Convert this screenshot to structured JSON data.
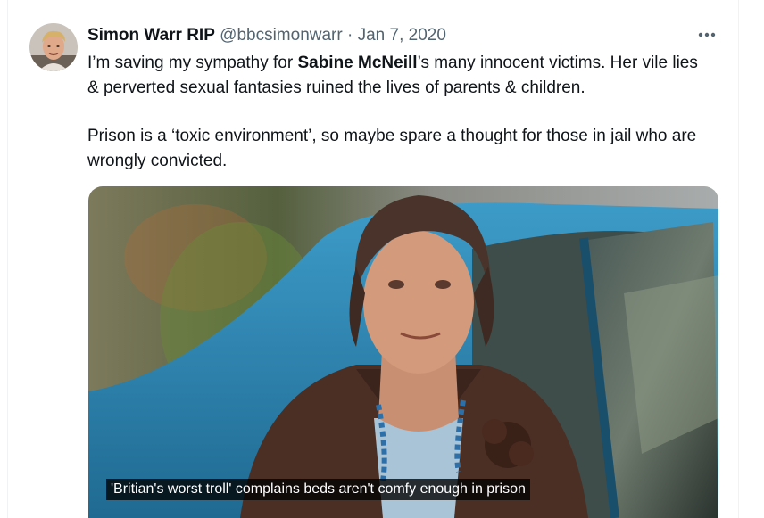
{
  "tweet": {
    "author_name": "Simon Warr RIP",
    "handle": "@bbcsimonwarr",
    "separator": "·",
    "date": "Jan 7, 2020",
    "more_label": "More",
    "text": {
      "p1_before": "I’m saving my sympathy for ",
      "p1_bold": "Sabine McNeill",
      "p1_after": "’s many innocent victims. Her vile lies & perverted sexual fantasies ruined the lives of parents & children.",
      "p2": "Prison is a ‘toxic environment’, so maybe spare a thought for those in jail who are wrongly convicted."
    },
    "media": {
      "caption": "'Britian's worst troll' complains beds aren't comfy enough in prison"
    }
  },
  "colors": {
    "text": "#0f1419",
    "secondary": "#536471",
    "border": "#eff3f4",
    "car_blue": "#2d7fa8"
  },
  "icons": {
    "more": "more-horizontal-icon",
    "avatar": "avatar-photo"
  }
}
